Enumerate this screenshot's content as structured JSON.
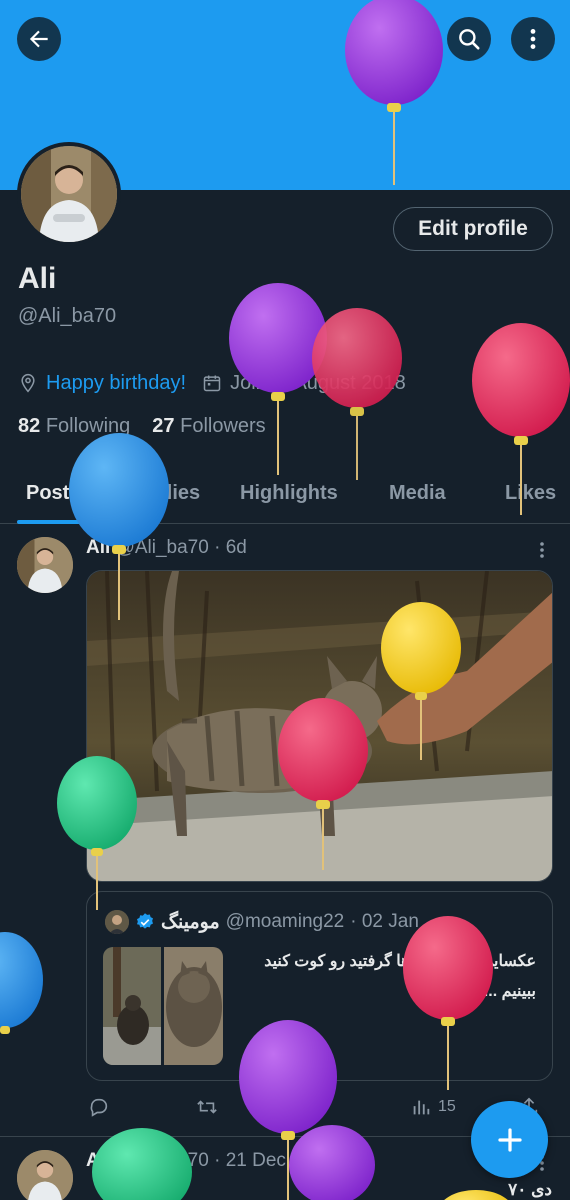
{
  "header": {
    "back_icon": "arrow-left-icon",
    "search_icon": "search-icon",
    "more_icon": "more-vertical-icon",
    "banner_color": "#1d9bf0"
  },
  "profile": {
    "edit_label": "Edit profile",
    "name": "Ali",
    "handle": "@Ali_ba70",
    "location_link": "Happy birthday!",
    "joined": "Joined August 2018",
    "following_count": "82",
    "following_label": "Following",
    "followers_count": "27",
    "followers_label": "Followers"
  },
  "tabs": [
    "Posts",
    "Replies",
    "Highlights",
    "Media",
    "Likes"
  ],
  "post": {
    "author": "Ali",
    "handle": "@Ali_ba70",
    "time": "· 6d",
    "quote": {
      "author": "مومینگ",
      "handle": "@moaming22",
      "time": "· 02 Jan",
      "text": "عکسایی که از گربه‌ها گرفتید رو کوت کنید ببینیم ..."
    },
    "views": "15"
  },
  "second_post": {
    "author": "Ali",
    "handle": "@Ali_ba70",
    "time": "· 21 Dec 23",
    "text": "دی ۷۰"
  },
  "accent": "#1d9bf0"
}
